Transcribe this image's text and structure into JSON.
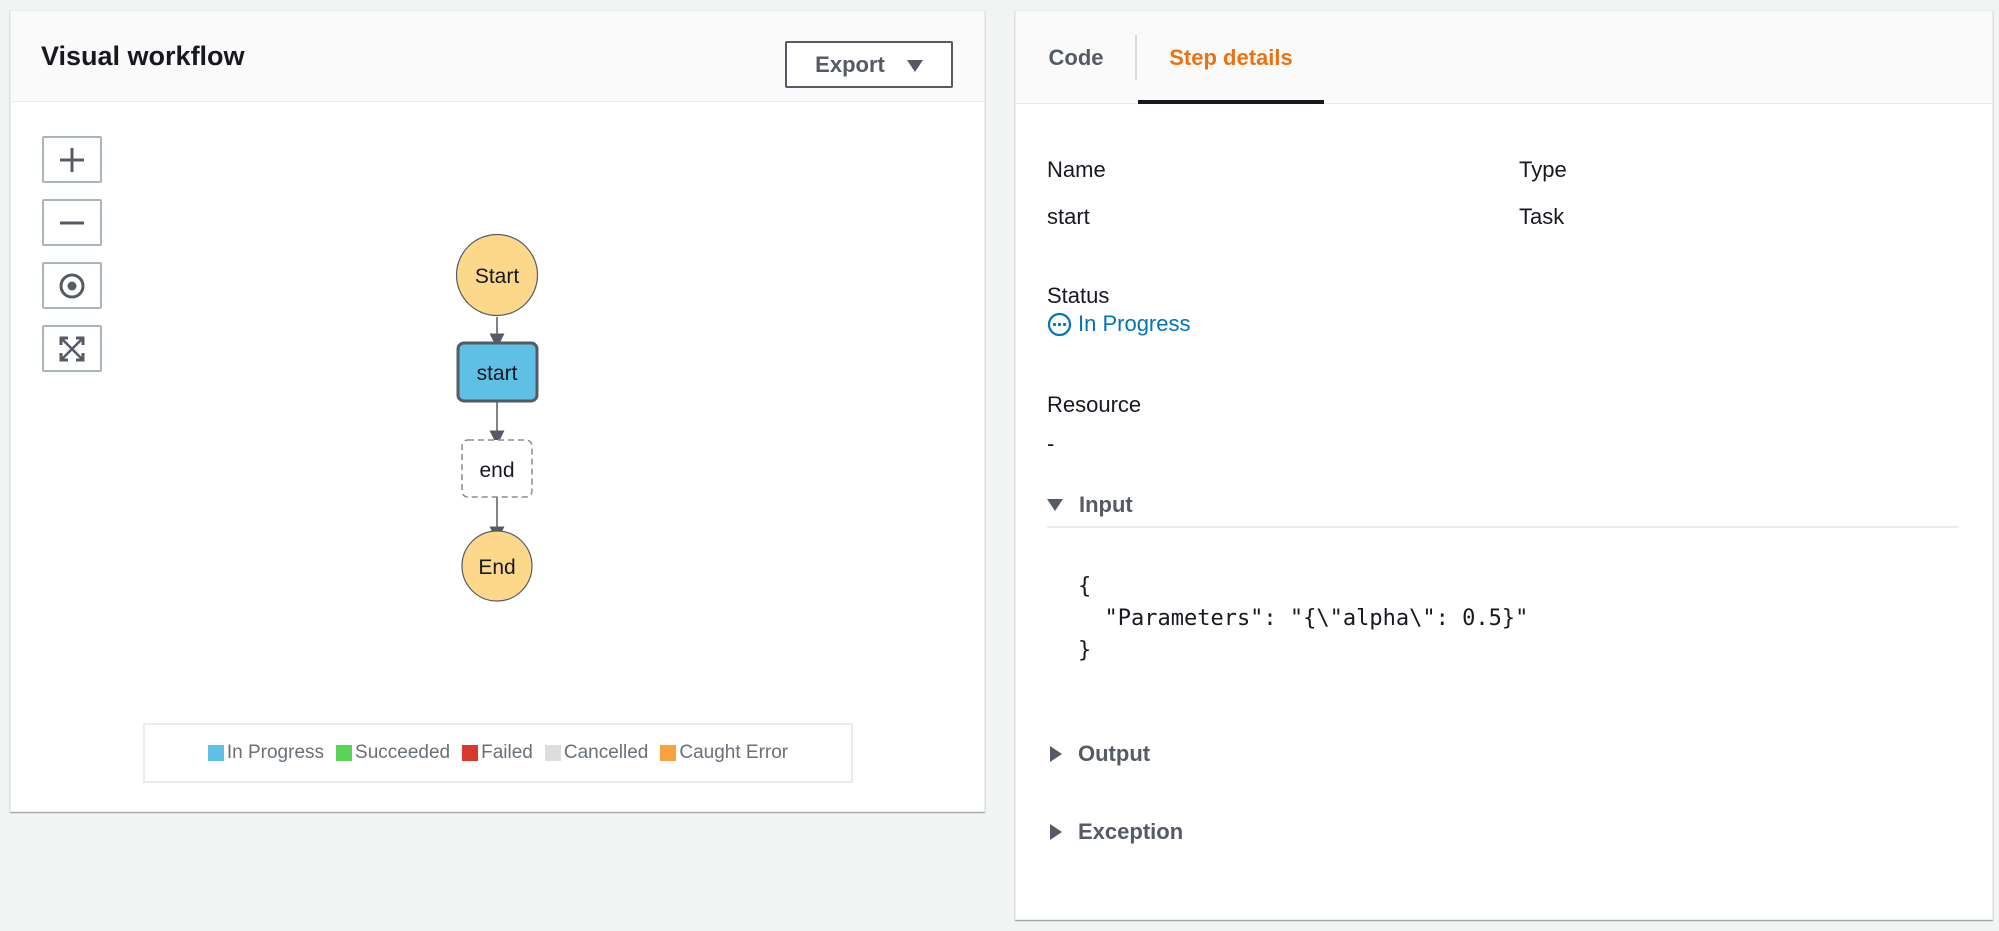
{
  "workflow": {
    "title": "Visual workflow",
    "export_label": "Export",
    "controls": [
      {
        "name": "zoom-in",
        "icon": "plus-icon"
      },
      {
        "name": "zoom-out",
        "icon": "minus-icon"
      },
      {
        "name": "center",
        "icon": "target-icon"
      },
      {
        "name": "fit",
        "icon": "expand-icon"
      }
    ],
    "nodes": {
      "start_terminal": "Start",
      "start_task": "start",
      "end_task": "end",
      "end_terminal": "End"
    },
    "colors": {
      "terminal": "#fcd98a",
      "in_progress": "#5fc0e6",
      "succeeded": "#5dd258",
      "failed": "#d93a2b",
      "cancelled": "#dddddd",
      "caught_error": "#f7a23c"
    },
    "legend": {
      "in_progress": "In Progress",
      "succeeded": "Succeeded",
      "failed": "Failed",
      "cancelled": "Cancelled",
      "caught_error": "Caught Error"
    }
  },
  "details": {
    "tabs": {
      "code": "Code",
      "step_details": "Step details"
    },
    "active_tab": "Step details",
    "name_label": "Name",
    "name_value": "start",
    "type_label": "Type",
    "type_value": "Task",
    "status_label": "Status",
    "status_value": "In Progress",
    "resource_label": "Resource",
    "resource_value": "-",
    "input_label": "Input",
    "input_code": "{\n  \"Parameters\": \"{\\\"alpha\\\": 0.5}\"\n}",
    "output_label": "Output",
    "exception_label": "Exception"
  }
}
